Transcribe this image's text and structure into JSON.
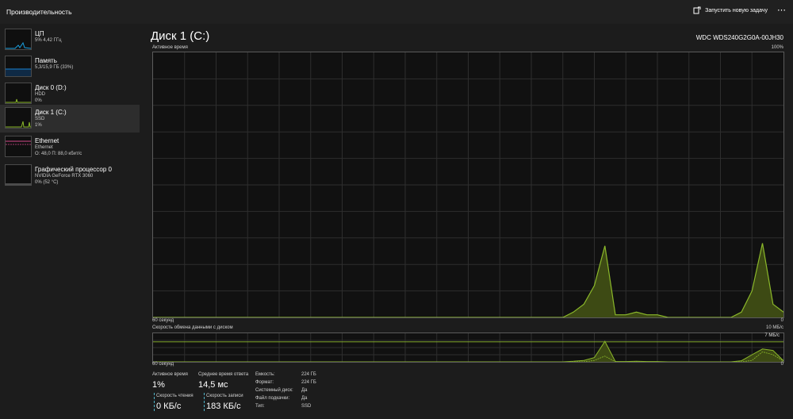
{
  "app": {
    "title": "Производительность",
    "run_task": "Запустить новую задачу",
    "more": "⋯"
  },
  "sidebar": {
    "items": [
      {
        "name": "ЦП",
        "sub1": "5% 4,42 ГГц",
        "color": "#1aa0e0"
      },
      {
        "name": "Память",
        "sub1": "5,3/15,9 ГБ (33%)",
        "color": "#1a82d0"
      },
      {
        "name": "Диск 0 (D:)",
        "sub1": "HDD",
        "sub2": "0%",
        "color": "#8bb82a"
      },
      {
        "name": "Диск 1 (C:)",
        "sub1": "SSD",
        "sub2": "1%",
        "color": "#8bb82a"
      },
      {
        "name": "Ethernet",
        "sub1": "Ethernet",
        "sub2": "О: 48,0 П: 88,0 кбит/с",
        "color": "#d04a8a"
      },
      {
        "name": "Графический процессор 0",
        "sub1": "NVIDIA GeForce RTX 3060",
        "sub2": "0% (52 °C)",
        "color": "#8a8a8a"
      }
    ]
  },
  "main": {
    "title": "Диск 1 (C:)",
    "model": "WDC WDS240G2G0A-00JH30",
    "graph1": {
      "label": "Активное время",
      "max": "100%",
      "time": "60 секунд",
      "min": "0"
    },
    "graph2": {
      "label": "Скорость обмена данными с диском",
      "max": "10 МБ/с",
      "scale": "7 МБ/с",
      "time": "60 секунд",
      "min": "0"
    }
  },
  "stats": {
    "active_label": "Активное время",
    "active_value": "1%",
    "resp_label": "Среднее время ответа",
    "resp_value": "14,5 мс",
    "read_label": "Скорость чтения",
    "read_value": "0 КБ/с",
    "write_label": "Скорость записи",
    "write_value": "183 КБ/с"
  },
  "properties": [
    {
      "label": "Емкость:",
      "value": "224 ГБ"
    },
    {
      "label": "Формат:",
      "value": "224 ГБ"
    },
    {
      "label": "Системный диск:",
      "value": "Да"
    },
    {
      "label": "Файл подкачки:",
      "value": "Да"
    },
    {
      "label": "Тип:",
      "value": "SSD"
    }
  ],
  "colors": {
    "disk": "#8bb82a",
    "read_write": "#4fb4c8",
    "accent_fill": "#3d4a14"
  },
  "chart_data": [
    {
      "type": "area",
      "title": "Активное время",
      "xlabel": "60 секунд",
      "ylim": [
        0,
        100
      ],
      "x": [
        0,
        1,
        2,
        3,
        4,
        5,
        6,
        7,
        8,
        9,
        10,
        11,
        12,
        13,
        14,
        15,
        16,
        17,
        18,
        19,
        20,
        21,
        22,
        23,
        24,
        25,
        26,
        27,
        28,
        29,
        30,
        31,
        32,
        33,
        34,
        35,
        36,
        37,
        38,
        39,
        40,
        41,
        42,
        43,
        44,
        45,
        46,
        47,
        48,
        49,
        50,
        51,
        52,
        53,
        54,
        55,
        56,
        57,
        58,
        59,
        60
      ],
      "values": [
        0,
        0,
        0,
        0,
        0,
        0,
        0,
        0,
        0,
        0,
        0,
        0,
        0,
        0,
        0,
        0,
        0,
        0,
        0,
        0,
        0,
        0,
        0,
        0,
        0,
        0,
        0,
        0,
        0,
        0,
        0,
        0,
        0,
        0,
        0,
        0,
        0,
        0,
        0,
        0,
        2,
        5,
        12,
        27,
        1,
        1,
        2,
        1,
        1,
        0,
        0,
        0,
        0,
        0,
        0,
        0,
        2,
        10,
        28,
        5,
        2
      ]
    },
    {
      "type": "line",
      "title": "Скорость обмена данными с диском",
      "ylim": [
        0,
        10
      ],
      "x": [
        0,
        1,
        2,
        3,
        4,
        5,
        6,
        7,
        8,
        9,
        10,
        11,
        12,
        13,
        14,
        15,
        16,
        17,
        18,
        19,
        20,
        21,
        22,
        23,
        24,
        25,
        26,
        27,
        28,
        29,
        30,
        31,
        32,
        33,
        34,
        35,
        36,
        37,
        38,
        39,
        40,
        41,
        42,
        43,
        44,
        45,
        46,
        47,
        48,
        49,
        50,
        51,
        52,
        53,
        54,
        55,
        56,
        57,
        58,
        59,
        60
      ],
      "series": [
        {
          "values": [
            0,
            0,
            0,
            0,
            0,
            0,
            0,
            0,
            0,
            0,
            0,
            0,
            0,
            0,
            0,
            0,
            0,
            0,
            0,
            0,
            0,
            0,
            0,
            0,
            0,
            0,
            0,
            0,
            0,
            0,
            0,
            0,
            0,
            0,
            0,
            0,
            0,
            0,
            0,
            0,
            0.2,
            0.5,
            1.5,
            7.2,
            0.1,
            0.1,
            0.2,
            0.1,
            0.1,
            0,
            0,
            0,
            0,
            0,
            0,
            0,
            0.4,
            2.5,
            4.5,
            4.0,
            0.4
          ]
        },
        {
          "values": [
            0,
            0,
            0,
            0,
            0,
            0,
            0,
            0,
            0,
            0,
            0,
            0,
            0,
            0,
            0,
            0,
            0,
            0,
            0,
            0,
            0,
            0,
            0,
            0,
            0,
            0,
            0,
            0,
            0,
            0,
            0,
            0,
            0,
            0,
            0,
            0,
            0,
            0,
            0,
            0,
            0,
            0,
            0.5,
            2.0,
            0,
            0,
            0,
            0,
            0,
            0,
            0,
            0,
            0,
            0,
            0,
            0,
            0,
            0.5,
            3.5,
            2.5,
            0.3
          ]
        }
      ]
    }
  ]
}
